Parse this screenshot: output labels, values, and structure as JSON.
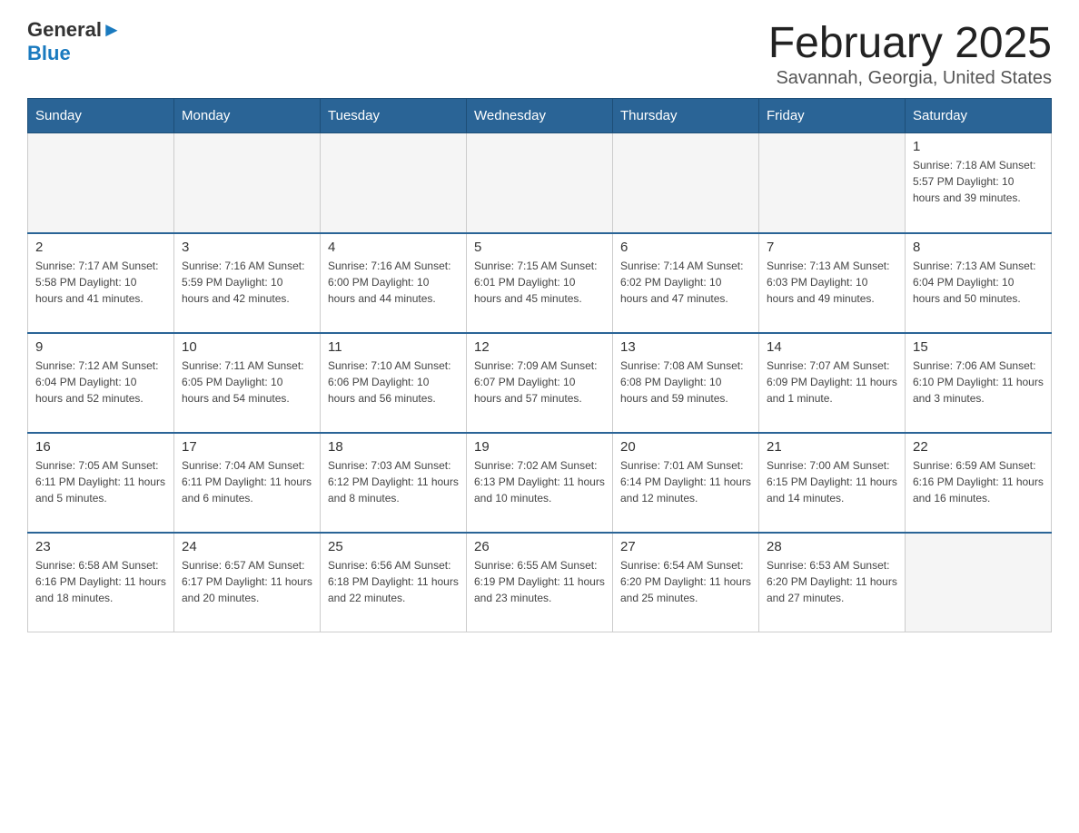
{
  "header": {
    "logo_general": "General",
    "logo_blue": "Blue",
    "title": "February 2025",
    "subtitle": "Savannah, Georgia, United States"
  },
  "days_of_week": [
    "Sunday",
    "Monday",
    "Tuesday",
    "Wednesday",
    "Thursday",
    "Friday",
    "Saturday"
  ],
  "weeks": [
    [
      {
        "day": "",
        "info": ""
      },
      {
        "day": "",
        "info": ""
      },
      {
        "day": "",
        "info": ""
      },
      {
        "day": "",
        "info": ""
      },
      {
        "day": "",
        "info": ""
      },
      {
        "day": "",
        "info": ""
      },
      {
        "day": "1",
        "info": "Sunrise: 7:18 AM\nSunset: 5:57 PM\nDaylight: 10 hours and 39 minutes."
      }
    ],
    [
      {
        "day": "2",
        "info": "Sunrise: 7:17 AM\nSunset: 5:58 PM\nDaylight: 10 hours and 41 minutes."
      },
      {
        "day": "3",
        "info": "Sunrise: 7:16 AM\nSunset: 5:59 PM\nDaylight: 10 hours and 42 minutes."
      },
      {
        "day": "4",
        "info": "Sunrise: 7:16 AM\nSunset: 6:00 PM\nDaylight: 10 hours and 44 minutes."
      },
      {
        "day": "5",
        "info": "Sunrise: 7:15 AM\nSunset: 6:01 PM\nDaylight: 10 hours and 45 minutes."
      },
      {
        "day": "6",
        "info": "Sunrise: 7:14 AM\nSunset: 6:02 PM\nDaylight: 10 hours and 47 minutes."
      },
      {
        "day": "7",
        "info": "Sunrise: 7:13 AM\nSunset: 6:03 PM\nDaylight: 10 hours and 49 minutes."
      },
      {
        "day": "8",
        "info": "Sunrise: 7:13 AM\nSunset: 6:04 PM\nDaylight: 10 hours and 50 minutes."
      }
    ],
    [
      {
        "day": "9",
        "info": "Sunrise: 7:12 AM\nSunset: 6:04 PM\nDaylight: 10 hours and 52 minutes."
      },
      {
        "day": "10",
        "info": "Sunrise: 7:11 AM\nSunset: 6:05 PM\nDaylight: 10 hours and 54 minutes."
      },
      {
        "day": "11",
        "info": "Sunrise: 7:10 AM\nSunset: 6:06 PM\nDaylight: 10 hours and 56 minutes."
      },
      {
        "day": "12",
        "info": "Sunrise: 7:09 AM\nSunset: 6:07 PM\nDaylight: 10 hours and 57 minutes."
      },
      {
        "day": "13",
        "info": "Sunrise: 7:08 AM\nSunset: 6:08 PM\nDaylight: 10 hours and 59 minutes."
      },
      {
        "day": "14",
        "info": "Sunrise: 7:07 AM\nSunset: 6:09 PM\nDaylight: 11 hours and 1 minute."
      },
      {
        "day": "15",
        "info": "Sunrise: 7:06 AM\nSunset: 6:10 PM\nDaylight: 11 hours and 3 minutes."
      }
    ],
    [
      {
        "day": "16",
        "info": "Sunrise: 7:05 AM\nSunset: 6:11 PM\nDaylight: 11 hours and 5 minutes."
      },
      {
        "day": "17",
        "info": "Sunrise: 7:04 AM\nSunset: 6:11 PM\nDaylight: 11 hours and 6 minutes."
      },
      {
        "day": "18",
        "info": "Sunrise: 7:03 AM\nSunset: 6:12 PM\nDaylight: 11 hours and 8 minutes."
      },
      {
        "day": "19",
        "info": "Sunrise: 7:02 AM\nSunset: 6:13 PM\nDaylight: 11 hours and 10 minutes."
      },
      {
        "day": "20",
        "info": "Sunrise: 7:01 AM\nSunset: 6:14 PM\nDaylight: 11 hours and 12 minutes."
      },
      {
        "day": "21",
        "info": "Sunrise: 7:00 AM\nSunset: 6:15 PM\nDaylight: 11 hours and 14 minutes."
      },
      {
        "day": "22",
        "info": "Sunrise: 6:59 AM\nSunset: 6:16 PM\nDaylight: 11 hours and 16 minutes."
      }
    ],
    [
      {
        "day": "23",
        "info": "Sunrise: 6:58 AM\nSunset: 6:16 PM\nDaylight: 11 hours and 18 minutes."
      },
      {
        "day": "24",
        "info": "Sunrise: 6:57 AM\nSunset: 6:17 PM\nDaylight: 11 hours and 20 minutes."
      },
      {
        "day": "25",
        "info": "Sunrise: 6:56 AM\nSunset: 6:18 PM\nDaylight: 11 hours and 22 minutes."
      },
      {
        "day": "26",
        "info": "Sunrise: 6:55 AM\nSunset: 6:19 PM\nDaylight: 11 hours and 23 minutes."
      },
      {
        "day": "27",
        "info": "Sunrise: 6:54 AM\nSunset: 6:20 PM\nDaylight: 11 hours and 25 minutes."
      },
      {
        "day": "28",
        "info": "Sunrise: 6:53 AM\nSunset: 6:20 PM\nDaylight: 11 hours and 27 minutes."
      },
      {
        "day": "",
        "info": ""
      }
    ]
  ]
}
